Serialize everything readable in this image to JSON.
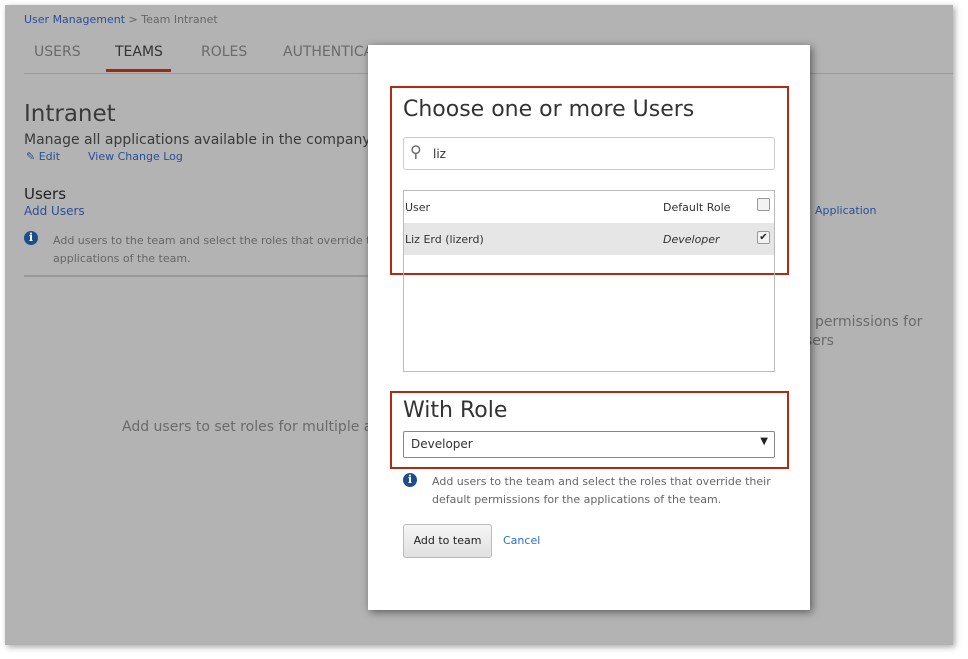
{
  "breadcrumb": {
    "root": "User Management",
    "separator": ">",
    "current": "Team Intranet"
  },
  "tabs": [
    {
      "label": "USERS",
      "active": false
    },
    {
      "label": "TEAMS",
      "active": true
    },
    {
      "label": "ROLES",
      "active": false
    },
    {
      "label": "AUTHENTICA",
      "active": false
    }
  ],
  "team": {
    "title": "Intranet",
    "description": "Manage all applications available in the company's In",
    "edit_label": "Edit",
    "change_log_label": "View Change Log"
  },
  "users_section": {
    "heading": "Users",
    "add_users_label": "Add Users",
    "info_line1": "Add users to the team and select the roles that override their",
    "info_line2": "applications of the team.",
    "empty_text": "Add users to set roles for multiple app"
  },
  "right_panel": {
    "link": "Application",
    "text_line1": "t permissions for",
    "text_line2": "sers"
  },
  "modal": {
    "title": "Choose one or more Users",
    "search": {
      "value": "liz",
      "icon": "search-icon"
    },
    "table": {
      "headers": {
        "user": "User",
        "default_role": "Default Role"
      },
      "select_all_checked": false,
      "rows": [
        {
          "user": "Liz Erd (lizerd)",
          "default_role": "Developer",
          "checked": true
        }
      ]
    },
    "role_heading": "With Role",
    "role_select": {
      "value": "Developer"
    },
    "info_line1": "Add users to the team and select the roles that override their",
    "info_line2": "default permissions for the applications of the team.",
    "add_button": "Add to team",
    "cancel_link": "Cancel"
  },
  "colors": {
    "accent": "#b22a12",
    "link": "#2a4f96",
    "overlay": "#b3b3b3",
    "info": "#1c4f8a"
  }
}
